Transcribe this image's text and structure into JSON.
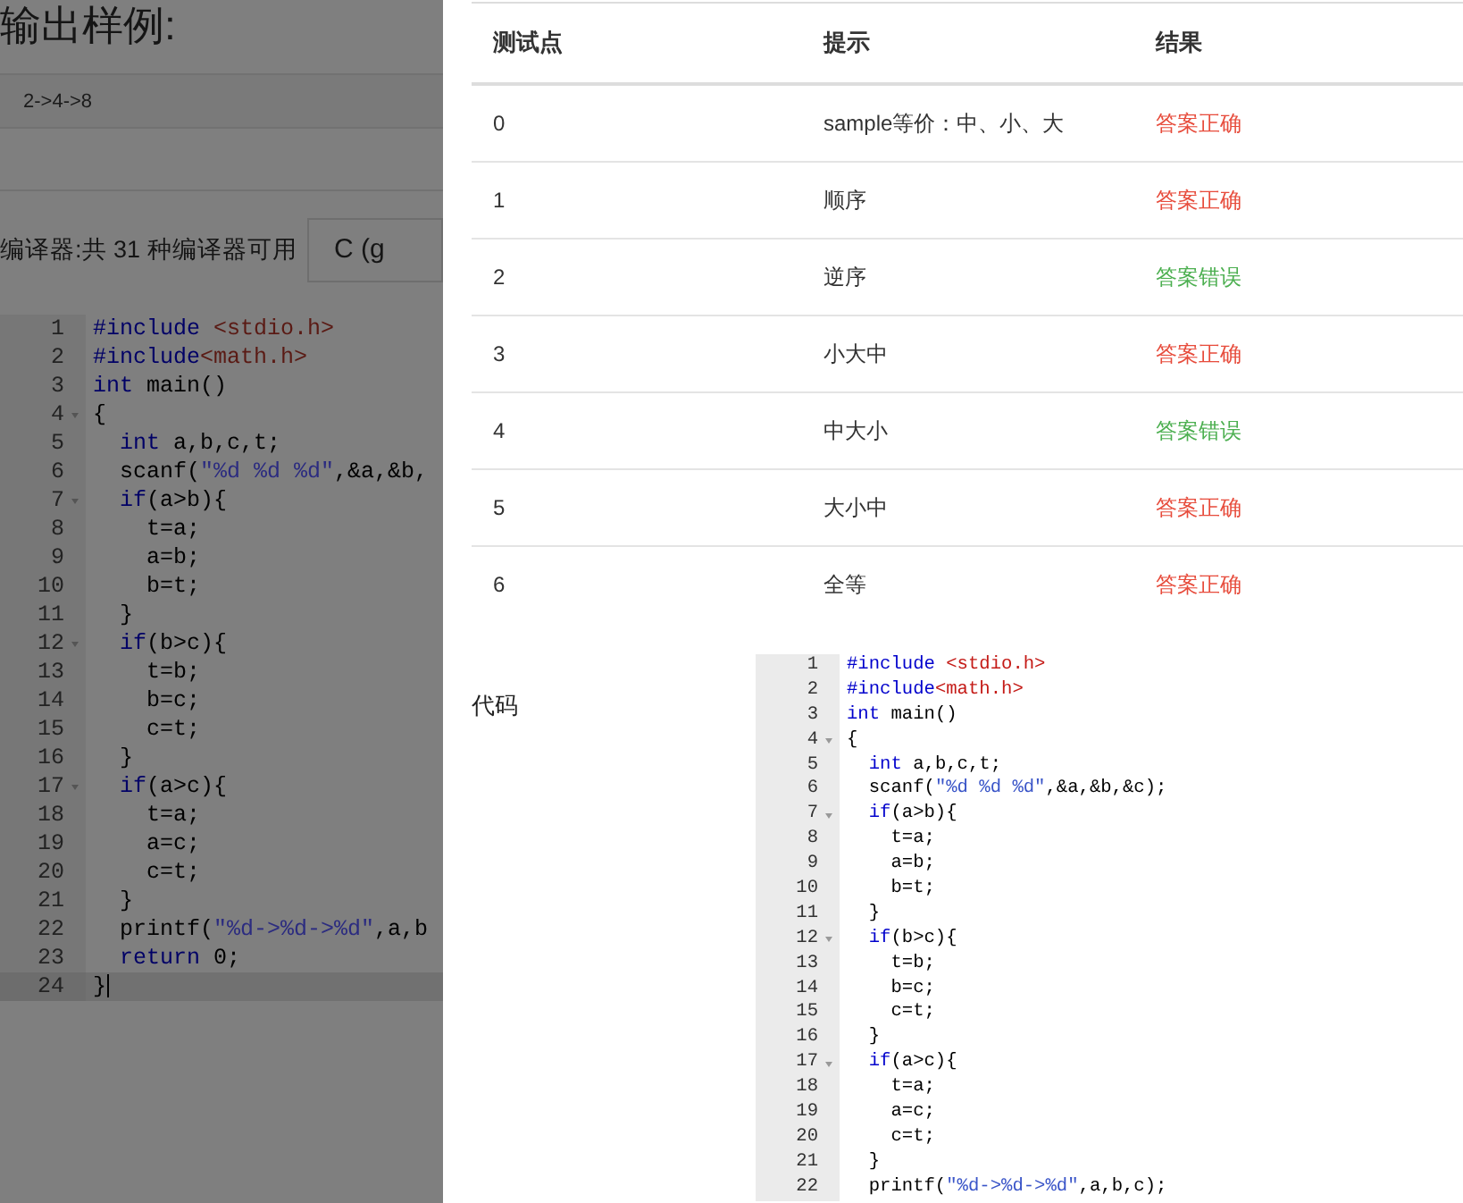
{
  "background_page": {
    "heading": "输出样例:",
    "sample_output": "2->4->8",
    "compiler_label": "编译器:共 31 种编译器可用",
    "compiler_select": "C (g",
    "code_lines": [
      {
        "number": "1",
        "fold": false,
        "active": false,
        "segments": [
          {
            "kind": "keyword",
            "text": "#include"
          },
          {
            "kind": "header",
            "text": " <stdio.h>"
          }
        ]
      },
      {
        "number": "2",
        "fold": false,
        "active": false,
        "segments": [
          {
            "kind": "keyword",
            "text": "#include"
          },
          {
            "kind": "header",
            "text": "<math.h>"
          }
        ]
      },
      {
        "number": "3",
        "fold": false,
        "active": false,
        "segments": [
          {
            "kind": "keyword",
            "text": "int"
          },
          {
            "kind": "plain",
            "text": " main()"
          }
        ]
      },
      {
        "number": "4",
        "fold": true,
        "active": false,
        "segments": [
          {
            "kind": "plain",
            "text": "{"
          }
        ]
      },
      {
        "number": "5",
        "fold": false,
        "active": false,
        "segments": [
          {
            "kind": "keyword",
            "text": "  int"
          },
          {
            "kind": "plain",
            "text": " a,b,c,t;"
          }
        ]
      },
      {
        "number": "6",
        "fold": false,
        "active": false,
        "segments": [
          {
            "kind": "plain",
            "text": "  scanf("
          },
          {
            "kind": "string",
            "text": "\"%d %d %d\""
          },
          {
            "kind": "plain",
            "text": ",&a,&b,"
          }
        ]
      },
      {
        "number": "7",
        "fold": true,
        "active": false,
        "segments": [
          {
            "kind": "keyword",
            "text": "  if"
          },
          {
            "kind": "plain",
            "text": "(a>b){"
          }
        ]
      },
      {
        "number": "8",
        "fold": false,
        "active": false,
        "segments": [
          {
            "kind": "plain",
            "text": "    t=a;"
          }
        ]
      },
      {
        "number": "9",
        "fold": false,
        "active": false,
        "segments": [
          {
            "kind": "plain",
            "text": "    a=b;"
          }
        ]
      },
      {
        "number": "10",
        "fold": false,
        "active": false,
        "segments": [
          {
            "kind": "plain",
            "text": "    b=t;"
          }
        ]
      },
      {
        "number": "11",
        "fold": false,
        "active": false,
        "segments": [
          {
            "kind": "plain",
            "text": "  }"
          }
        ]
      },
      {
        "number": "12",
        "fold": true,
        "active": false,
        "segments": [
          {
            "kind": "keyword",
            "text": "  if"
          },
          {
            "kind": "plain",
            "text": "(b>c){"
          }
        ]
      },
      {
        "number": "13",
        "fold": false,
        "active": false,
        "segments": [
          {
            "kind": "plain",
            "text": "    t=b;"
          }
        ]
      },
      {
        "number": "14",
        "fold": false,
        "active": false,
        "segments": [
          {
            "kind": "plain",
            "text": "    b=c;"
          }
        ]
      },
      {
        "number": "15",
        "fold": false,
        "active": false,
        "segments": [
          {
            "kind": "plain",
            "text": "    c=t;"
          }
        ]
      },
      {
        "number": "16",
        "fold": false,
        "active": false,
        "segments": [
          {
            "kind": "plain",
            "text": "  }"
          }
        ]
      },
      {
        "number": "17",
        "fold": true,
        "active": false,
        "segments": [
          {
            "kind": "keyword",
            "text": "  if"
          },
          {
            "kind": "plain",
            "text": "(a>c){"
          }
        ]
      },
      {
        "number": "18",
        "fold": false,
        "active": false,
        "segments": [
          {
            "kind": "plain",
            "text": "    t=a;"
          }
        ]
      },
      {
        "number": "19",
        "fold": false,
        "active": false,
        "segments": [
          {
            "kind": "plain",
            "text": "    a=c;"
          }
        ]
      },
      {
        "number": "20",
        "fold": false,
        "active": false,
        "segments": [
          {
            "kind": "plain",
            "text": "    c=t;"
          }
        ]
      },
      {
        "number": "21",
        "fold": false,
        "active": false,
        "segments": [
          {
            "kind": "plain",
            "text": "  }"
          }
        ]
      },
      {
        "number": "22",
        "fold": false,
        "active": false,
        "segments": [
          {
            "kind": "plain",
            "text": "  printf("
          },
          {
            "kind": "string",
            "text": "\"%d->%d->%d\""
          },
          {
            "kind": "plain",
            "text": ",a,b"
          }
        ]
      },
      {
        "number": "23",
        "fold": false,
        "active": false,
        "segments": [
          {
            "kind": "keyword",
            "text": "  return"
          },
          {
            "kind": "plain",
            "text": " 0;"
          }
        ]
      },
      {
        "number": "24",
        "fold": false,
        "active": true,
        "segments": [
          {
            "kind": "plain",
            "text": "}"
          }
        ]
      }
    ]
  },
  "drawer": {
    "table": {
      "columns": [
        "测试点",
        "提示",
        "结果"
      ],
      "rows": [
        {
          "case": "0",
          "hint": "sample等价：中、小、大",
          "result": "答案正确",
          "color": "#e74c3c"
        },
        {
          "case": "1",
          "hint": "顺序",
          "result": "答案正确",
          "color": "#e74c3c"
        },
        {
          "case": "2",
          "hint": "逆序",
          "result": "答案错误",
          "color": "#4caf50"
        },
        {
          "case": "3",
          "hint": "小大中",
          "result": "答案正确",
          "color": "#e74c3c"
        },
        {
          "case": "4",
          "hint": "中大小",
          "result": "答案错误",
          "color": "#4caf50"
        },
        {
          "case": "5",
          "hint": "大小中",
          "result": "答案正确",
          "color": "#e74c3c"
        },
        {
          "case": "6",
          "hint": "全等",
          "result": "答案正确",
          "color": "#e74c3c"
        }
      ]
    },
    "code_label": "代码",
    "code_lines": [
      {
        "number": "1",
        "fold": false,
        "segments": [
          {
            "kind": "keyword",
            "text": "#include"
          },
          {
            "kind": "header",
            "text": " <stdio.h>"
          }
        ]
      },
      {
        "number": "2",
        "fold": false,
        "segments": [
          {
            "kind": "keyword",
            "text": "#include"
          },
          {
            "kind": "header",
            "text": "<math.h>"
          }
        ]
      },
      {
        "number": "3",
        "fold": false,
        "segments": [
          {
            "kind": "keyword",
            "text": "int"
          },
          {
            "kind": "plain",
            "text": " main()"
          }
        ]
      },
      {
        "number": "4",
        "fold": true,
        "segments": [
          {
            "kind": "plain",
            "text": "{"
          }
        ]
      },
      {
        "number": "5",
        "fold": false,
        "segments": [
          {
            "kind": "keyword",
            "text": "  int"
          },
          {
            "kind": "plain",
            "text": " a,b,c,t;"
          }
        ]
      },
      {
        "number": "6",
        "fold": false,
        "segments": [
          {
            "kind": "plain",
            "text": "  scanf("
          },
          {
            "kind": "string",
            "text": "\"%d %d %d\""
          },
          {
            "kind": "plain",
            "text": ",&a,&b,&c);"
          }
        ]
      },
      {
        "number": "7",
        "fold": true,
        "segments": [
          {
            "kind": "keyword",
            "text": "  if"
          },
          {
            "kind": "plain",
            "text": "(a>b){"
          }
        ]
      },
      {
        "number": "8",
        "fold": false,
        "segments": [
          {
            "kind": "plain",
            "text": "    t=a;"
          }
        ]
      },
      {
        "number": "9",
        "fold": false,
        "segments": [
          {
            "kind": "plain",
            "text": "    a=b;"
          }
        ]
      },
      {
        "number": "10",
        "fold": false,
        "segments": [
          {
            "kind": "plain",
            "text": "    b=t;"
          }
        ]
      },
      {
        "number": "11",
        "fold": false,
        "segments": [
          {
            "kind": "plain",
            "text": "  }"
          }
        ]
      },
      {
        "number": "12",
        "fold": true,
        "segments": [
          {
            "kind": "keyword",
            "text": "  if"
          },
          {
            "kind": "plain",
            "text": "(b>c){"
          }
        ]
      },
      {
        "number": "13",
        "fold": false,
        "segments": [
          {
            "kind": "plain",
            "text": "    t=b;"
          }
        ]
      },
      {
        "number": "14",
        "fold": false,
        "segments": [
          {
            "kind": "plain",
            "text": "    b=c;"
          }
        ]
      },
      {
        "number": "15",
        "fold": false,
        "segments": [
          {
            "kind": "plain",
            "text": "    c=t;"
          }
        ]
      },
      {
        "number": "16",
        "fold": false,
        "segments": [
          {
            "kind": "plain",
            "text": "  }"
          }
        ]
      },
      {
        "number": "17",
        "fold": true,
        "segments": [
          {
            "kind": "keyword",
            "text": "  if"
          },
          {
            "kind": "plain",
            "text": "(a>c){"
          }
        ]
      },
      {
        "number": "18",
        "fold": false,
        "segments": [
          {
            "kind": "plain",
            "text": "    t=a;"
          }
        ]
      },
      {
        "number": "19",
        "fold": false,
        "segments": [
          {
            "kind": "plain",
            "text": "    a=c;"
          }
        ]
      },
      {
        "number": "20",
        "fold": false,
        "segments": [
          {
            "kind": "plain",
            "text": "    c=t;"
          }
        ]
      },
      {
        "number": "21",
        "fold": false,
        "segments": [
          {
            "kind": "plain",
            "text": "  }"
          }
        ]
      },
      {
        "number": "22",
        "fold": false,
        "segments": [
          {
            "kind": "plain",
            "text": "  printf("
          },
          {
            "kind": "string",
            "text": "\"%d->%d->%d\""
          },
          {
            "kind": "plain",
            "text": ",a,b,c);"
          }
        ]
      }
    ]
  }
}
